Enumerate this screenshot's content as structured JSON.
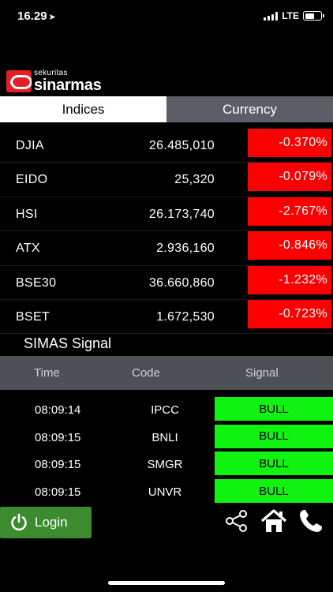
{
  "status_bar": {
    "time": "16.29",
    "network": "LTE"
  },
  "logo": {
    "small_text": "sekuritas",
    "big_text": "sinarmas"
  },
  "tabs": [
    {
      "label": "Indices",
      "active": true
    },
    {
      "label": "Currency",
      "active": false
    }
  ],
  "indices": [
    {
      "name": "DJIA",
      "value": "26.485,010",
      "change": "-0.370%"
    },
    {
      "name": "EIDO",
      "value": "25,320",
      "change": "-0.079%"
    },
    {
      "name": "HSI",
      "value": "26.173,740",
      "change": "-2.767%"
    },
    {
      "name": "ATX",
      "value": "2.936,160",
      "change": "-0.846%"
    },
    {
      "name": "BSE30",
      "value": "36.660,860",
      "change": "-1.232%"
    },
    {
      "name": "BSET",
      "value": "1.672,530",
      "change": "-0.723%"
    }
  ],
  "signal": {
    "title": "SIMAS Signal",
    "headers": {
      "time": "Time",
      "code": "Code",
      "signal": "Signal"
    },
    "rows": [
      {
        "time": "08:09:14",
        "code": "IPCC",
        "signal": "BULL"
      },
      {
        "time": "08:09:15",
        "code": "BNLI",
        "signal": "BULL"
      },
      {
        "time": "08:09:15",
        "code": "SMGR",
        "signal": "BULL"
      },
      {
        "time": "08:09:15",
        "code": "UNVR",
        "signal": "BULL"
      }
    ]
  },
  "bottom": {
    "login_label": "Login"
  },
  "colors": {
    "negative": "#fb0000",
    "bull": "#10f210",
    "login": "#3c8b2e",
    "brand": "#e31e24"
  },
  "icons": [
    "location-arrow-icon",
    "signal-icon",
    "battery-icon",
    "power-icon",
    "share-icon",
    "home-icon",
    "phone-icon"
  ]
}
